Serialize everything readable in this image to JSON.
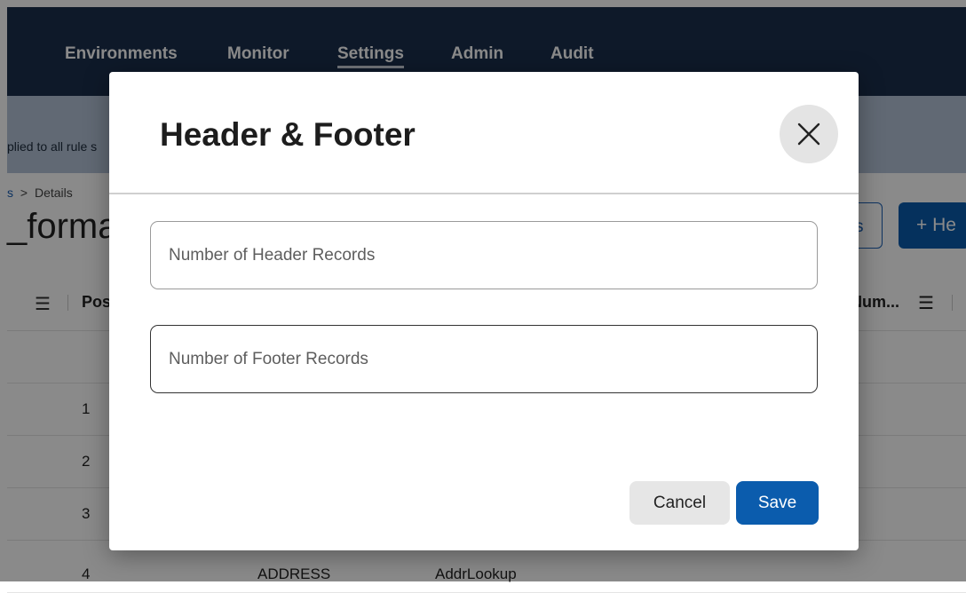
{
  "nav": {
    "items": [
      "Environments",
      "Monitor",
      "Settings",
      "Admin",
      "Audit"
    ],
    "active": "Settings"
  },
  "banner": {
    "text": "plied to all rule s"
  },
  "breadcrumb": {
    "link": "s",
    "separator": ">",
    "current": "Details"
  },
  "page": {
    "title": "_forma"
  },
  "toolbar": {
    "outline_label": "s",
    "primary_label": "+ He"
  },
  "grid": {
    "pos_header": "Pos",
    "num_header": "Num...",
    "rows": [
      {
        "pos": ""
      },
      {
        "pos": "1"
      },
      {
        "pos": "2"
      },
      {
        "pos": "3"
      },
      {
        "pos": "4",
        "name": "ADDRESS",
        "lookup": "AddrLookup"
      }
    ]
  },
  "modal": {
    "title": "Header & Footer",
    "header_field": {
      "placeholder": "Number of Header Records",
      "value": ""
    },
    "footer_field": {
      "placeholder": "Number of Footer Records",
      "value": ""
    },
    "cancel_label": "Cancel",
    "save_label": "Save"
  },
  "colors": {
    "nav_bg": "#1b2f4d",
    "banner_bg": "#b3c3d7",
    "primary": "#0b5cad",
    "cancel_bg": "#e6e6e6"
  }
}
